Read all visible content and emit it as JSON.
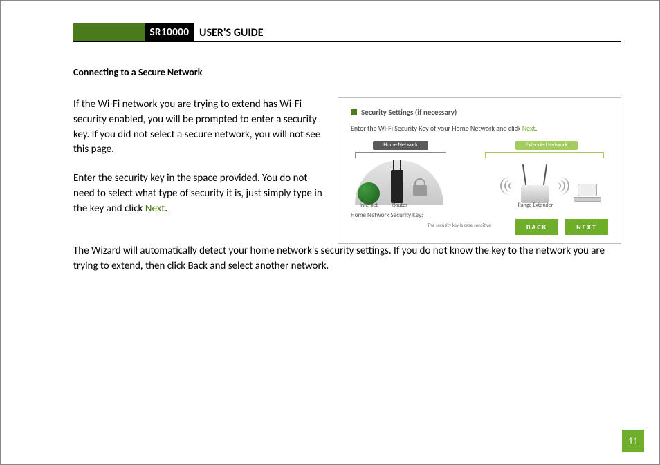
{
  "header": {
    "product": "SR10000",
    "title": "USER'S GUIDE"
  },
  "section": {
    "title": "Connecting to a Secure Network"
  },
  "para1": "If the Wi-Fi network you are trying to extend has Wi-Fi security enabled, you will be prompted to enter a security key.  If you did not select a secure network, you will not see this page.",
  "para2a": "Enter the security key in the space provided.  You do not need to select what type of security it is, just simply type in the key and click ",
  "para2b": "Next",
  "para2c": ".",
  "para3": "The Wizard will automatically detect your home network's security settings. If you do not know the key to the network you are trying to extend, then click Back and select another network.",
  "fig": {
    "title": "Security Settings (if necessary)",
    "sub_a": "Enter the Wi-Fi Security Key of your Home Network and click ",
    "sub_b": "Next",
    "sub_c": ".",
    "tab_home": "Home Network",
    "tab_ext": "Extended Network",
    "lbl_internet": "Internet",
    "lbl_router": "Router",
    "lbl_range": "Range Extender",
    "key_label": "Home Network Security Key:",
    "key_note": "The security key is case sensitive",
    "btn_back": "BACK",
    "btn_next": "NEXT"
  },
  "page_number": "11"
}
